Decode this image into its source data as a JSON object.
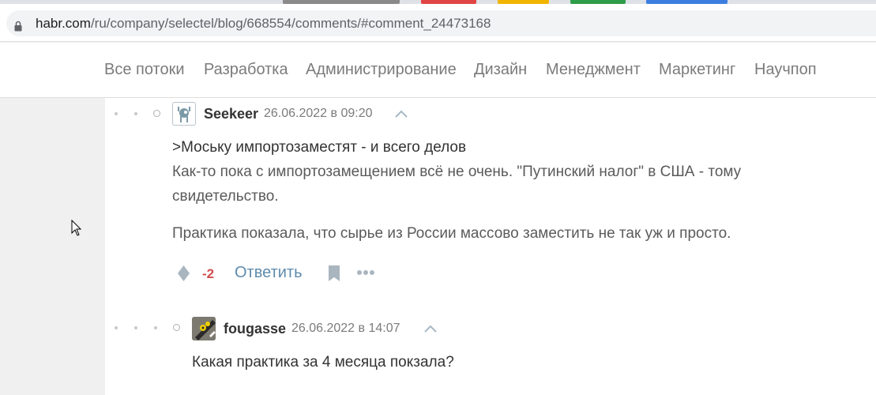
{
  "browser": {
    "url_host": "habr.com",
    "url_path": "/ru/company/selectel/blog/668554/comments/#comment_24473168"
  },
  "nav": {
    "items": [
      "Все потоки",
      "Разработка",
      "Администрирование",
      "Дизайн",
      "Менеджмент",
      "Маркетинг",
      "Научпоп"
    ]
  },
  "comments": [
    {
      "username": "Seekeer",
      "date": "26.06.2022 в 09:20",
      "lines": [
        ">Моську импортозаместят - и всего делов",
        "Как-то пока с импортозамещением всё не очень. \"Путинский налог\" в США - тому",
        "свидетельство.",
        "Практика показала, что сырье из России массово заместить не так уж и просто."
      ],
      "rating": "-2",
      "reply_label": "Ответить"
    },
    {
      "username": "fougasse",
      "date": "26.06.2022 в 14:07",
      "lines": [
        "Какая практика за 4 месяца покзала?"
      ]
    }
  ],
  "colors": {
    "rating_negative": "#d04e4e",
    "reply_link": "#5e8bad"
  }
}
